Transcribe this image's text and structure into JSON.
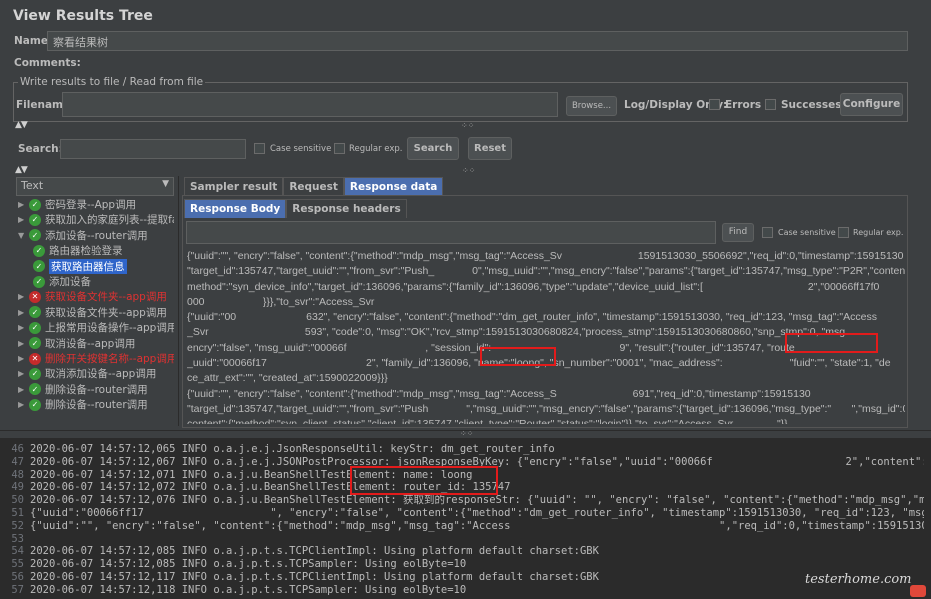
{
  "window": {
    "title": "View Results Tree",
    "name_label": "Name:",
    "name_value": "察看结果树",
    "comments_label": "Comments:"
  },
  "write_results": {
    "legend": "Write results to file / Read from file",
    "filename_label": "Filename",
    "browse_label": "Browse...",
    "log_display_label": "Log/Display Only:",
    "errors_label": "Errors",
    "successes_label": "Successes",
    "configure_label": "Configure"
  },
  "search": {
    "label": "Search:",
    "case_sensitive": "Case sensitive",
    "regular_exp": "Regular exp.",
    "search_button": "Search",
    "reset_button": "Reset"
  },
  "tree": {
    "renderer": "Text",
    "items": [
      {
        "label": "密码登录--App调用",
        "status": "ok",
        "level": 0,
        "state": "collapsed"
      },
      {
        "label": "获取加入的家庭列表--提取fam",
        "status": "ok",
        "level": 0,
        "state": "collapsed"
      },
      {
        "label": "添加设备--router调用",
        "status": "ok",
        "level": 0,
        "state": "expanded"
      },
      {
        "label": "路由器检验登录",
        "status": "ok",
        "level": 1,
        "state": "leaf"
      },
      {
        "label": "获取路由器信息",
        "status": "ok",
        "level": 1,
        "state": "leaf",
        "selected": true
      },
      {
        "label": "添加设备",
        "status": "ok",
        "level": 1,
        "state": "leaf"
      },
      {
        "label": "获取设备文件夹--app调用",
        "status": "error",
        "level": 0,
        "state": "collapsed"
      },
      {
        "label": "获取设备文件夹--app调用",
        "status": "ok",
        "level": 0,
        "state": "collapsed"
      },
      {
        "label": "上报常用设备操作--app调用",
        "status": "ok",
        "level": 0,
        "state": "collapsed"
      },
      {
        "label": "取消设备--app调用",
        "status": "ok",
        "level": 0,
        "state": "collapsed"
      },
      {
        "label": "删除开关按键名称--app调用",
        "status": "error",
        "level": 0,
        "state": "collapsed"
      },
      {
        "label": "取消添加设备--app调用",
        "status": "ok",
        "level": 0,
        "state": "collapsed"
      },
      {
        "label": "删除设备--router调用",
        "status": "ok",
        "level": 0,
        "state": "collapsed"
      },
      {
        "label": "删除设备--router调用",
        "status": "ok",
        "level": 0,
        "state": "collapsed"
      }
    ]
  },
  "result_tabs": [
    "Sampler result",
    "Request",
    "Response data"
  ],
  "response_tabs": [
    "Response Body",
    "Response headers"
  ],
  "response_search": {
    "find_button": "Find",
    "case_sensitive": "Case sensitive",
    "regular_exp": "Regular exp."
  },
  "response_body_lines": [
    "{\"uuid\":\"\", \"encry\":\"false\", \"content\":{\"method\":\"mdp_msg\",\"msg_tag\":\"Access_Sv                          1591513030_5506692\",\"req_id\":0,\"timestamp\":15915130",
    "\"target_id\":135747,\"target_uuid\":\"\",\"from_svr\":\"Push_             0\",\"msg_uuid\":\"\",\"msg_encry\":\"false\",\"params\":{\"target_id\":135747,\"msg_type\":\"P2R\",\"content\":{",
    "method\":\"syn_device_info\",\"target_id\":136096,\"params\":{\"family_id\":136096,\"type\":\"update\",\"device_uuid_list\":[                                    2\",\"00066ff17f0",
    "000                    }}},\"to_svr\":\"Access_Svr",
    "{\"uuid\":\"00                        632\", \"encry\":\"false\", \"content\":{\"method\":\"dm_get_router_info\", \"timestamp\":1591513030, \"req_id\":123, \"msg_tag\":\"Access",
    "_Svr                                 593\", \"code\":0, \"msg\":\"OK\",\"rcv_stmp\":1591513030680824,\"process_stmp\":1591513030680860,\"snp_stmp\":0, \"msg",
    "encry\":\"false\", \"msg_uuid\":\"00066f                           , \"session_id\":                                            9\", \"result\":{\"router_id\":135747, \"route",
    "_uuid\":\"00066f17                                  2\", \"family_id\":136096, \"name\":\"loong\", \"sn_number\":\"0001\", \"mac_address\":                       \"fuid\":\"\", \"state\":1, \"de",
    "ce_attr_ext\":\"\", \"created_at\":1590022009}}}",
    "{\"uuid\":\"\", \"encry\":\"false\", \"content\":{\"method\":\"mdp_msg\",\"msg_tag\":\"Access_S                          691\",\"req_id\":0,\"timestamp\":15915130",
    "\"target_id\":135747,\"target_uuid\":\"\",\"from_svr\":\"Push             \",\"msg_uuid\":\"\",\"msg_encry\":\"false\",\"params\":{\"target_id\":136096,\"msg_type\":\"       \",\"msg_id\":0",
    "content\":{\"method\":\"syn_client_status\",\"client_id\":135747,\"client_type\":\"Router\",\"status\":\"login\"}},\"to_svr\":\"Access_Svr               \"}}"
  ],
  "log": {
    "lines": [
      {
        "no": "46",
        "text": "2020-06-07 14:57:12,065 INFO o.a.j.e.j.JsonResponseUtil: keyStr: dm_get_router_info"
      },
      {
        "no": "47",
        "text": "2020-06-07 14:57:12,067 INFO o.a.j.e.j.JSONPostProcessor: jsonResponseByKey: {\"encry\":\"false\",\"uuid\":\"00066f                     2\",\"content\":{\"msg_tag\":\""
      },
      {
        "no": "48",
        "text": "2020-06-07 14:57:12,071 INFO o.a.j.u.BeanShellTestElement: name: loong"
      },
      {
        "no": "49",
        "text": "2020-06-07 14:57:12,072 INFO o.a.j.u.BeanShellTestElement: router_id: 135747"
      },
      {
        "no": "50",
        "text": "2020-06-07 14:57:12,076 INFO o.a.j.u.BeanShellTestElement: 获取到的responseStr: {\"uuid\": \"\", \"encry\": \"false\", \"content\":{\"method\":\"mdp_msg\",\"msg_tag\":\"Access_Svr"
      },
      {
        "no": "51",
        "text": "{\"uuid\":\"00066ff17                    \", \"encry\":\"false\", \"content\":{\"method\":\"dm_get_router_info\", \"timestamp\":1591513030, \"req_id\":123, \"msg_tag\":\"Access_S"
      },
      {
        "no": "52",
        "text": "{\"uuid\":\"\", \"encry\":\"false\", \"content\":{\"method\":\"mdp_msg\",\"msg_tag\":\"Access                                 \",\"req_id\":0,\"timestamp\":1591513030,\"targ"
      },
      {
        "no": "53",
        "text": ""
      },
      {
        "no": "54",
        "text": "2020-06-07 14:57:12,085 INFO o.a.j.p.t.s.TCPClientImpl: Using platform default charset:GBK"
      },
      {
        "no": "55",
        "text": "2020-06-07 14:57:12,085 INFO o.a.j.p.t.s.TCPSampler: Using eolByte=10"
      },
      {
        "no": "56",
        "text": "2020-06-07 14:57:12,117 INFO o.a.j.p.t.s.TCPClientImpl: Using platform default charset:GBK"
      },
      {
        "no": "57",
        "text": "2020-06-07 14:57:12,118 INFO o.a.j.p.t.s.TCPSampler: Using eolByte=10"
      }
    ]
  },
  "watermark": "testerhome.com"
}
